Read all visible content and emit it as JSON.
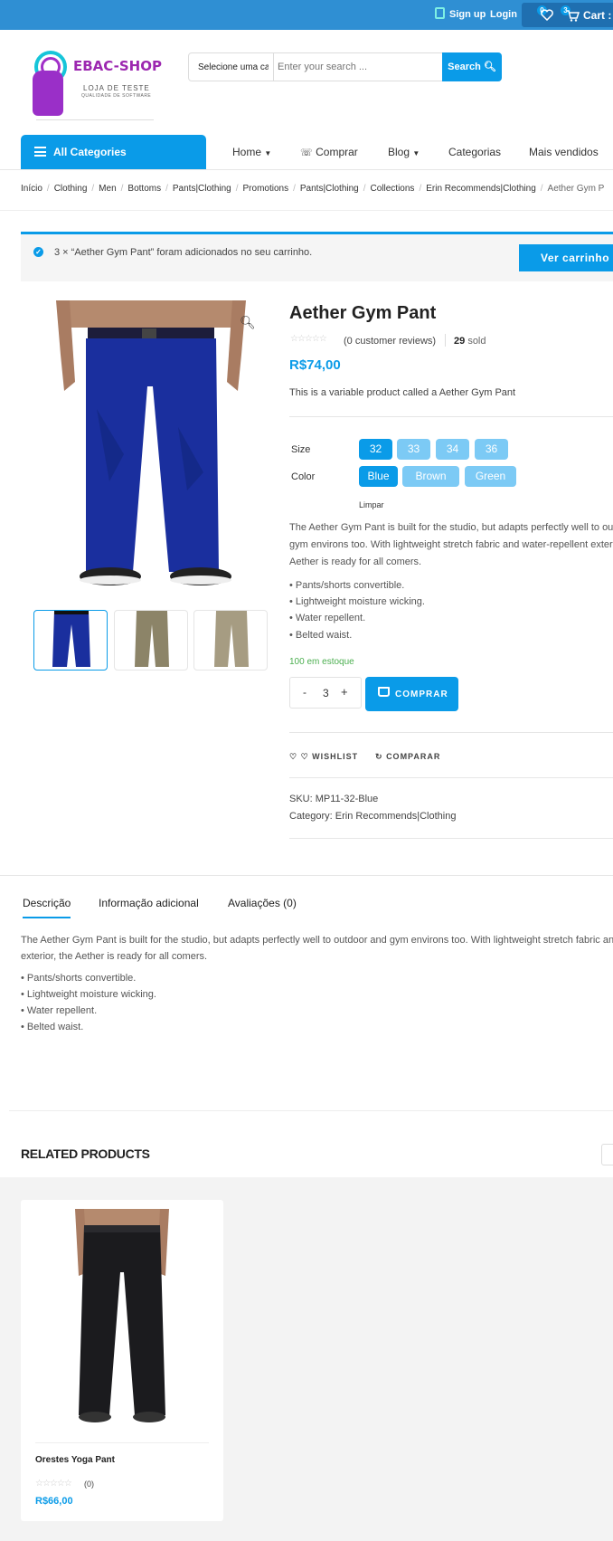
{
  "topbar": {
    "signup": "Sign up",
    "login": "Login",
    "wishlist_count": "0",
    "cart_count": "3",
    "cart_label": "Cart : R"
  },
  "logo": {
    "title": "EBAC-SHOP",
    "subtitle": "LOJA DE TESTE",
    "tagline": "QUALIDADE DE SOFTWARE"
  },
  "search": {
    "category": "Selecione uma cat",
    "placeholder": "Enter your search ...",
    "button": "Search"
  },
  "nav": {
    "all_categories": "All Categories",
    "items": [
      "Home",
      "Comprar",
      "Blog",
      "Categorias",
      "Mais vendidos"
    ]
  },
  "breadcrumb": [
    "Início",
    "Clothing",
    "Men",
    "Bottoms",
    "Pants|Clothing",
    "Promotions",
    "Pants|Clothing",
    "Collections",
    "Erin Recommends|Clothing",
    "Aether Gym P"
  ],
  "notice": {
    "message": "3 × “Aether Gym Pant” foram adicionados no seu carrinho.",
    "button": "Ver carrinho"
  },
  "product": {
    "title": "Aether Gym Pant",
    "reviews": "(0 customer reviews)",
    "sold_count": "29",
    "sold_label": "sold",
    "price": "R$74,00",
    "short_description": "This is a variable product called a Aether Gym Pant",
    "size_label": "Size",
    "sizes": [
      "32",
      "33",
      "34",
      "36"
    ],
    "color_label": "Color",
    "colors": [
      "Blue",
      "Brown",
      "Green"
    ],
    "clear": "Limpar",
    "description_lines": [
      "The Aether Gym Pant is built for the studio, but adapts perfectly well to outdo",
      "gym environs too. With lightweight stretch fabric and water-repellent exterio",
      "Aether is ready for all comers."
    ],
    "bullets": [
      "• Pants/shorts convertible.",
      "• Lightweight moisture wicking.",
      "• Water repellent.",
      "• Belted waist."
    ],
    "stock": "100 em estoque",
    "qty_minus": "-",
    "qty_value": "3",
    "qty_plus": "+",
    "buy_button": "COMPRAR",
    "wishlist": "WISHLIST",
    "compare": "COMPARAR",
    "sku_label": "SKU:",
    "sku": "MP11-32-Blue",
    "category_label": "Category:",
    "category": "Erin Recommends|Clothing"
  },
  "tabs": {
    "items": [
      "Descrição",
      "Informação adicional",
      "Avaliações (0)"
    ],
    "description_lines": [
      "The Aether Gym Pant is built for the studio, but adapts perfectly well to outdoor and gym environs too. With lightweight stretch fabric and wat",
      "exterior, the Aether is ready for all comers."
    ],
    "bullets": [
      "• Pants/shorts convertible.",
      "• Lightweight moisture wicking.",
      "• Water repellent.",
      "• Belted waist."
    ]
  },
  "related": {
    "heading": "RELATED PRODUCTS",
    "products": [
      {
        "name": "Orestes Yoga Pant",
        "reviews": "(0)",
        "price": "R$66,00"
      }
    ]
  },
  "colors": {
    "accent": "#0a9be8",
    "topbar": "#2f8fd3",
    "brand": "#9c27b0",
    "stock": "#4caf50"
  }
}
